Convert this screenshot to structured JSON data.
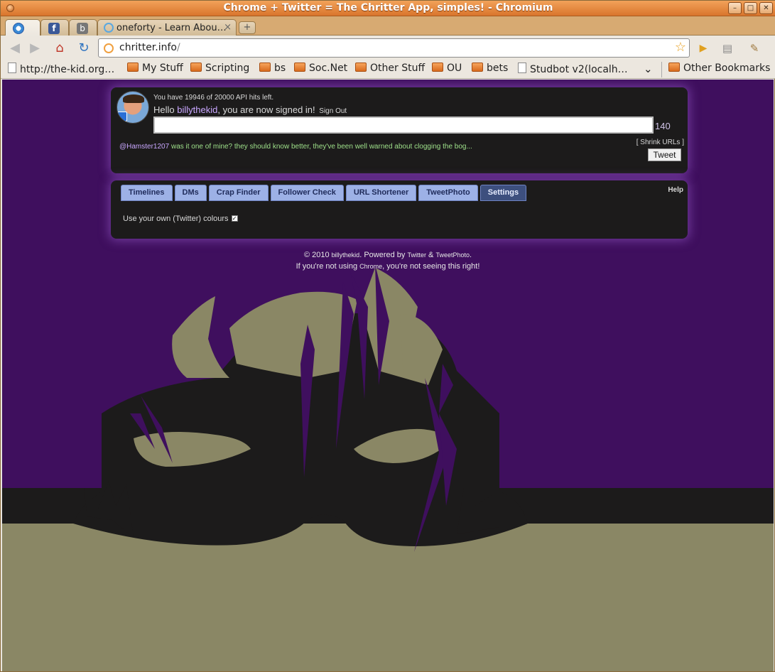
{
  "window": {
    "title": "Chrome + Twitter = The Chritter App, simples! - Chromium",
    "buttons": [
      "–",
      "□",
      "✕"
    ]
  },
  "tabs": [
    {
      "title": "",
      "icon": "chrome-icon"
    },
    {
      "title": "",
      "icon": "facebook-icon"
    },
    {
      "title": "",
      "icon": "b-icon"
    },
    {
      "title": "oneforty - Learn Abou…",
      "icon": "loading-icon",
      "close": "×"
    }
  ],
  "toolbar": {
    "url_host": "chritter.info",
    "url_path": "/"
  },
  "bookmarks": [
    {
      "label": "http://the-kid.org…",
      "type": "page"
    },
    {
      "label": "My Stuff",
      "type": "folder"
    },
    {
      "label": "Scripting",
      "type": "folder"
    },
    {
      "label": "bs",
      "type": "folder"
    },
    {
      "label": "Soc.Net",
      "type": "folder"
    },
    {
      "label": "Other Stuff",
      "type": "folder"
    },
    {
      "label": "OU",
      "type": "folder"
    },
    {
      "label": "bets",
      "type": "folder"
    },
    {
      "label": "Studbot v2(localh…",
      "type": "page"
    }
  ],
  "bookmarks_more": "»",
  "other_bookmarks": "Other Bookmarks",
  "app": {
    "api_hits": "You have 19946 of 20000 API hits left.",
    "hello_prefix": "Hello ",
    "username": "billythekid",
    "hello_suffix": ", you are now signed in!",
    "sign_out": "Sign Out",
    "char_count": "140",
    "last_tweet_mention": "@Hamster1207",
    "last_tweet_text": " was it one of mine? they should know better, they've been well warned about clogging the bog...",
    "shrink_urls": "[ Shrink URLs ]",
    "tweet_button": "Tweet",
    "tabs": [
      "Timelines",
      "DMs",
      "Crap Finder",
      "Follower Check",
      "URL Shortener",
      "TweetPhoto",
      "Settings"
    ],
    "active_tab": "Settings",
    "help": "Help",
    "setting_label": "Use your own (Twitter) colours",
    "setting_checked": true
  },
  "footer": {
    "line1_prefix": "© 2010 ",
    "line1_user": "billythekid",
    "line1_mid": ". Powered by ",
    "line1_twitter": "Twitter",
    "line1_amp": " & ",
    "line1_tweetphoto": "TweetPhoto",
    "line1_end": ".",
    "line2_prefix": "If you're not using ",
    "line2_chrome": "Chrome",
    "line2_suffix": ", you're not seeing this right!"
  },
  "colors": {
    "page_bg": "#3f0f5e",
    "mask_black": "#1c1b1b",
    "mask_khaki": "#8a8765",
    "hair_purple": "#3f0f5e",
    "panel_bg": "#1c1b1b",
    "tab_blue": "#9db1e6",
    "tab_active": "#3d4f7e"
  }
}
